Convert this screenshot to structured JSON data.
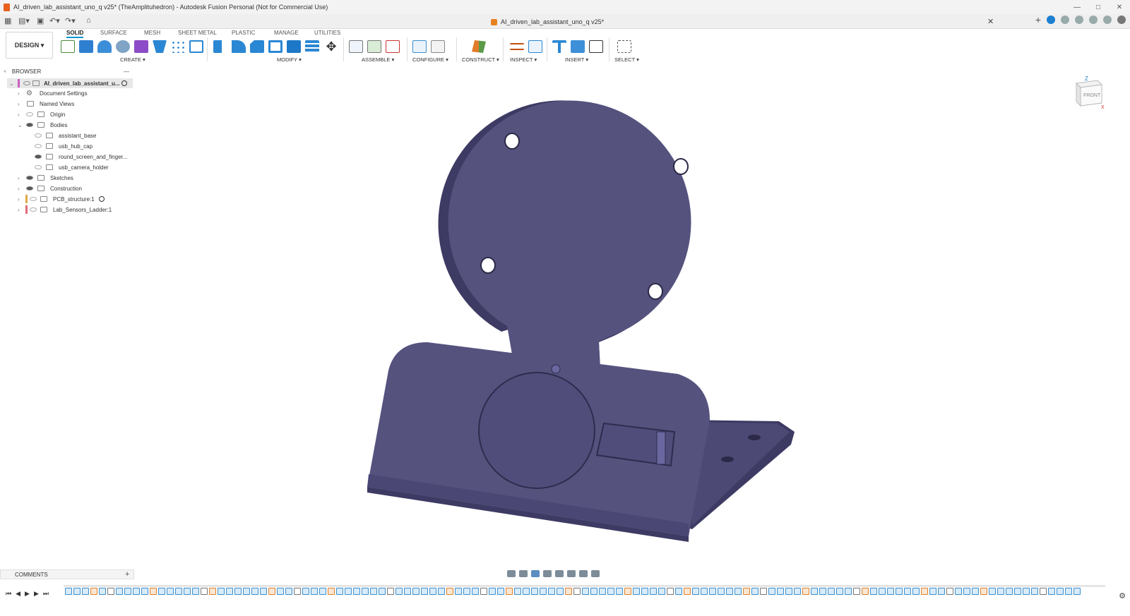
{
  "titlebar": {
    "title": "AI_driven_lab_assistant_uno_q v25* (TheAmplituhedron) - Autodesk Fusion Personal (Not for Commercial Use)"
  },
  "doc_tab": {
    "label": "AI_driven_lab_assistant_uno_q v25*"
  },
  "workspace": {
    "label": "DESIGN"
  },
  "ribbon_tabs": [
    "SOLID",
    "SURFACE",
    "MESH",
    "SHEET METAL",
    "PLASTIC",
    "MANAGE",
    "UTILITIES"
  ],
  "tool_groups": {
    "create": "CREATE",
    "modify": "MODIFY",
    "assemble": "ASSEMBLE",
    "configure": "CONFIGURE",
    "construct": "CONSTRUCT",
    "inspect": "INSPECT",
    "insert": "INSERT",
    "select": "SELECT"
  },
  "browser": {
    "header": "BROWSER",
    "root": "AI_driven_lab_assistant_u...",
    "items": [
      {
        "label": "Document Settings"
      },
      {
        "label": "Named Views"
      },
      {
        "label": "Origin"
      },
      {
        "label": "Bodies"
      },
      {
        "label": "assistant_base"
      },
      {
        "label": "usb_hub_cap"
      },
      {
        "label": "round_screen_and_finger..."
      },
      {
        "label": "usb_camera_holder"
      },
      {
        "label": "Sketches"
      },
      {
        "label": "Construction"
      },
      {
        "label": "PCB_structure:1"
      },
      {
        "label": "Lab_Sensors_Ladder:1"
      }
    ]
  },
  "viewcube": {
    "face": "FRONT",
    "axis_z": "Z",
    "axis_x": "X"
  },
  "comments": {
    "label": "COMMENTS"
  },
  "colors": {
    "body": "#55527e",
    "body_dark": "#3d3a63",
    "body_light": "#6a67a0",
    "accent": "#0696d7"
  }
}
